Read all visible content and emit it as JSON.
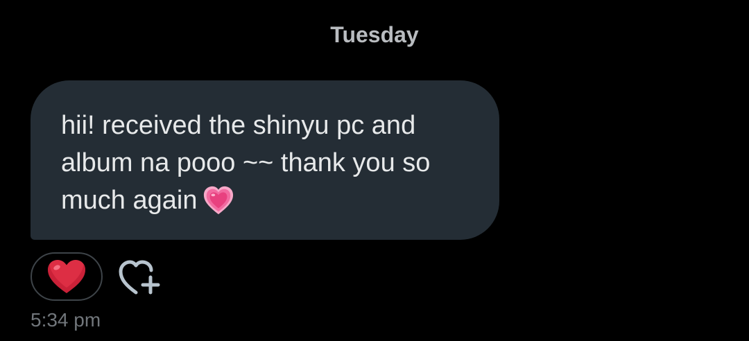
{
  "conversation": {
    "date_separator": "Tuesday"
  },
  "message": {
    "lines": [
      "hii! received the shinyu pc and",
      "album na pooo ~~ thank you so",
      "much again"
    ],
    "trailing_emoji": "growing-heart-icon",
    "timestamp": "5:34 pm"
  },
  "reactions": {
    "items": [
      {
        "emoji": "red-heart-icon"
      }
    ],
    "add_reaction_icon": "heart-plus-icon"
  },
  "colors": {
    "background": "#000000",
    "bubble": "#242d35",
    "text": "#e7e9ea",
    "muted": "#71767b",
    "date": "#b9bcc0",
    "pill_border": "#3e4449",
    "heart_red": "#e0245e",
    "pink_heart": "#f0619a"
  }
}
